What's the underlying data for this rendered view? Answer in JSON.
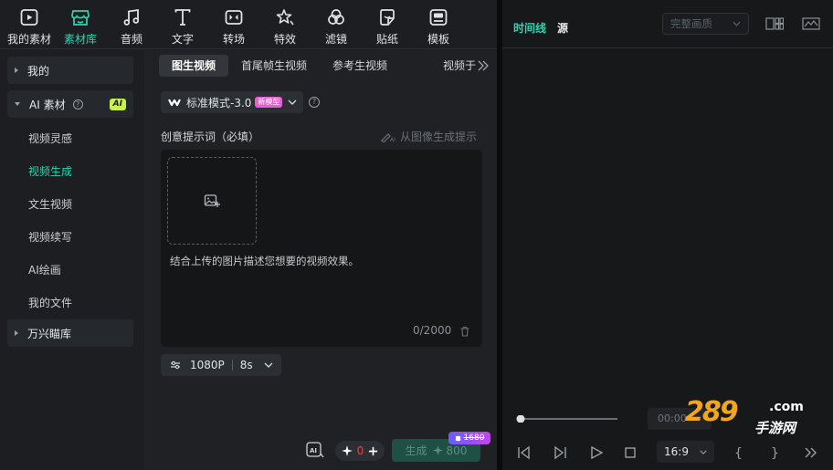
{
  "toolbar": {
    "items": [
      {
        "label": "我的素材",
        "icon": "my-media-icon"
      },
      {
        "label": "素材库",
        "icon": "store-icon"
      },
      {
        "label": "音频",
        "icon": "music-note-icon"
      },
      {
        "label": "文字",
        "icon": "text-t-icon"
      },
      {
        "label": "转场",
        "icon": "transition-icon"
      },
      {
        "label": "特效",
        "icon": "effects-star-icon"
      },
      {
        "label": "滤镜",
        "icon": "filter-icon"
      },
      {
        "label": "贴纸",
        "icon": "sticker-icon"
      },
      {
        "label": "模板",
        "icon": "template-icon"
      }
    ],
    "active_index": 1,
    "accent_color": "#2fd5b0"
  },
  "sidebar": {
    "mine": "我的",
    "ai_section": "AI 素材",
    "ai_help": "?",
    "ai_badge": "AI",
    "items": [
      "视频灵感",
      "视频生成",
      "文生视频",
      "视频续写",
      "AI绘画",
      "我的文件"
    ],
    "active_item": "视频生成",
    "library": "万兴瞄库"
  },
  "tabs": {
    "items": [
      "图生视频",
      "首尾帧生视频",
      "参考生视频"
    ],
    "cut_tab": "视频于",
    "active": "图生视频"
  },
  "mode": {
    "label": "标准模式-3.0",
    "badge": "新模型",
    "help": "?"
  },
  "prompt": {
    "label": "创意提示词（必填）",
    "from_image": "从图像生成提示",
    "placeholder": "结合上传的图片描述您想要的视频效果。",
    "count": "0/2000"
  },
  "settings": {
    "resolution": "1080P",
    "duration": "8s"
  },
  "bottom": {
    "credit_count": "0",
    "generate_label": "生成",
    "cost": "800",
    "old_price": "1680"
  },
  "preview": {
    "tab_timeline": "时间线",
    "tab_source": "源",
    "quality": "完整画质",
    "time": "00:00",
    "ratio": "16:9",
    "playhead_progress": 0
  },
  "watermark": {
    "number": "289",
    "com": ".com",
    "cn": "手游网"
  }
}
